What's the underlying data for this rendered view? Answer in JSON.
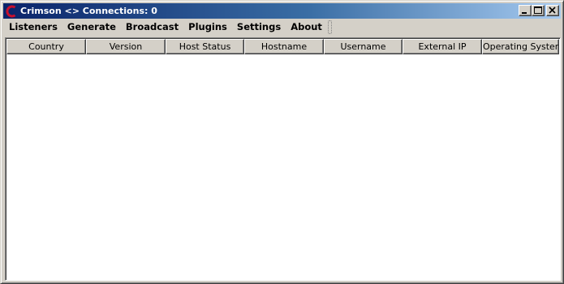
{
  "window": {
    "title": "Crimson <> Connections: 0",
    "icon": "crimson-c-logo-icon",
    "accent_color": "#0a246a",
    "caption_buttons": {
      "minimize": "minimize-icon",
      "maximize": "maximize-icon",
      "close": "close-icon"
    }
  },
  "menu": {
    "items": [
      {
        "label": "Listeners"
      },
      {
        "label": "Generate"
      },
      {
        "label": "Broadcast"
      },
      {
        "label": "Plugins"
      },
      {
        "label": "Settings"
      },
      {
        "label": "About"
      }
    ]
  },
  "table": {
    "columns": [
      {
        "label": "Country"
      },
      {
        "label": "Version"
      },
      {
        "label": "Host Status"
      },
      {
        "label": "Hostname"
      },
      {
        "label": "Username"
      },
      {
        "label": "External IP"
      },
      {
        "label": "Operating System"
      }
    ],
    "rows": []
  }
}
